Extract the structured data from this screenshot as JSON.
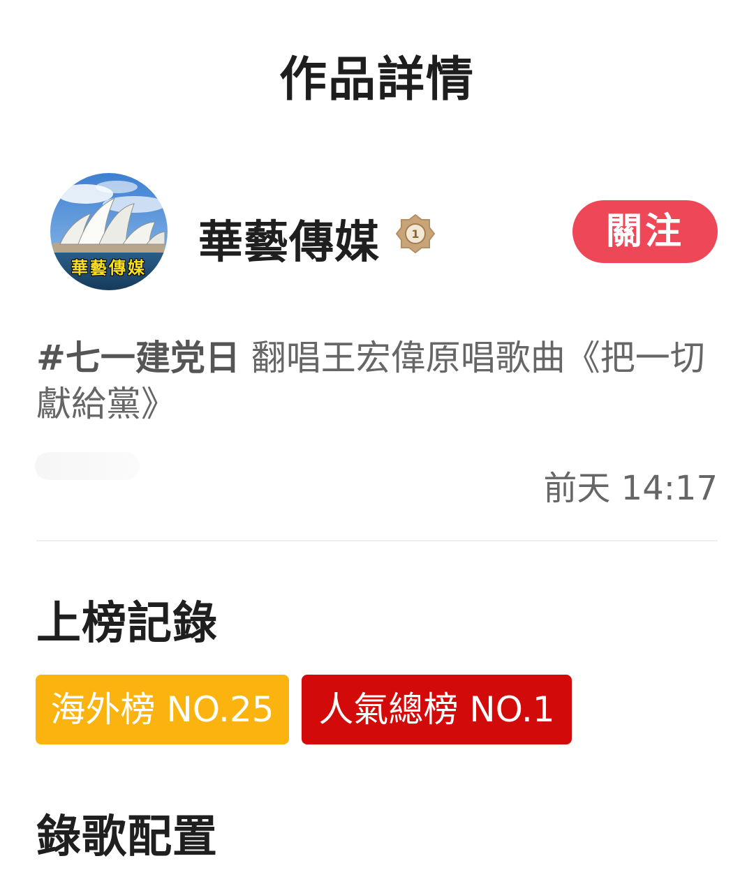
{
  "header": {
    "title": "作品詳情"
  },
  "author": {
    "avatar_caption": "華藝傳媒",
    "name": "華藝傳媒",
    "rank_badge_number": "1",
    "follow_label": "關注"
  },
  "post": {
    "hashtag": "#七一建党日",
    "description": " 翻唱王宏偉原唱歌曲《把一切獻給黨》",
    "timestamp": "前天 14:17"
  },
  "chart_records": {
    "title": "上榜記錄",
    "tags": [
      {
        "label": "海外榜 NO.25",
        "color": "#fbb40f"
      },
      {
        "label": "人氣總榜 NO.1",
        "color": "#d20a0a"
      }
    ]
  },
  "recording_config": {
    "title": "錄歌配置"
  },
  "colors": {
    "follow_button": "#ee4757",
    "text_primary": "#1f1f1f",
    "text_secondary": "#666666"
  },
  "icons": {
    "rank_badge": "gold-octagon-rank-badge-icon"
  }
}
